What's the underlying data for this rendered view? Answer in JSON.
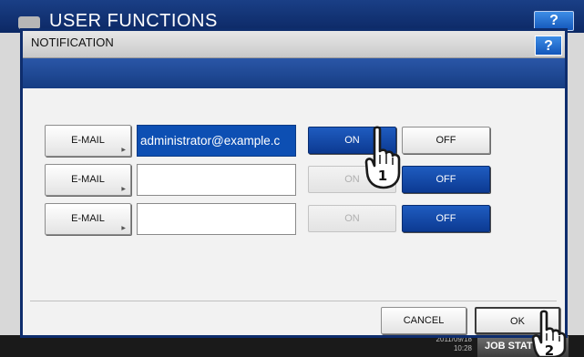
{
  "background": {
    "title": "USER FUNCTIONS",
    "help_label": "?",
    "datetime_line1": "2011/09/18",
    "datetime_line2": "10:28",
    "job_status_label": "JOB STATUS"
  },
  "dialog": {
    "title": "NOTIFICATION",
    "help_label": "?",
    "rows": [
      {
        "email_label": "E-MAIL",
        "address": "administrator@example.c",
        "on_label": "ON",
        "off_label": "OFF"
      },
      {
        "email_label": "E-MAIL",
        "address": "",
        "on_label": "ON",
        "off_label": "OFF"
      },
      {
        "email_label": "E-MAIL",
        "address": "",
        "on_label": "ON",
        "off_label": "OFF"
      }
    ],
    "cancel_label": "CANCEL",
    "ok_label": "OK"
  },
  "annotations": {
    "callout_1": "1",
    "callout_2": "2"
  },
  "colors": {
    "selected_blue": "#0d4fb3",
    "title_navy": "#0e2d6d"
  }
}
